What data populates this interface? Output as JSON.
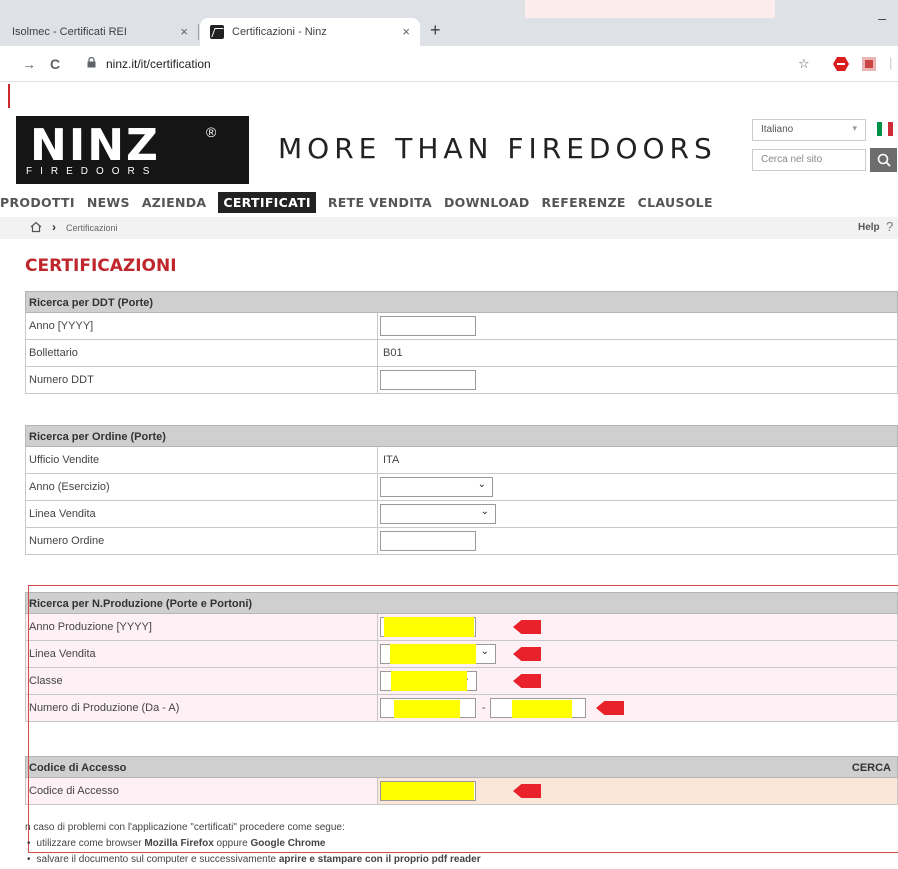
{
  "browser": {
    "tabs": [
      {
        "title": "Isolmec - Certificati REI",
        "active": false
      },
      {
        "title": "Certificazioni - Ninz",
        "active": true
      }
    ],
    "new_tab": "+",
    "close": "×",
    "minimize": "–",
    "url": "ninz.it/it/certification",
    "back": "→",
    "reload": "C",
    "star": "☆"
  },
  "header": {
    "logo_text": "NINZ",
    "logo_sub": "FIREDOORS",
    "logo_reg": "®",
    "slogan": "MORE THAN FIREDOORS",
    "language": "Italiano",
    "search_placeholder": "Cerca nel sito"
  },
  "nav": {
    "items": [
      "PRODOTTI",
      "NEWS",
      "AZIENDA",
      "CERTIFICATI",
      "RETE VENDITA",
      "DOWNLOAD",
      "REFERENZE",
      "CLAUSOLE"
    ],
    "active": "CERTIFICATI"
  },
  "breadcrumb": {
    "current": "Certificazioni",
    "help": "Help",
    "help_q": "?"
  },
  "page_title": "CERTIFICAZIONI",
  "sections": {
    "ddt": {
      "title": "Ricerca per DDT (Porte)",
      "rows": [
        "Anno [YYYY]",
        "Bollettario",
        "Numero DDT"
      ],
      "bollettario_value": "B01"
    },
    "ordine": {
      "title": "Ricerca per Ordine (Porte)",
      "rows": [
        "Ufficio Vendite",
        "Anno (Esercizio)",
        "Linea Vendita",
        "Numero Ordine"
      ],
      "ufficio_value": "ITA"
    },
    "produzione": {
      "title": "Ricerca per N.Produzione (Porte e Portoni)",
      "rows": [
        "Anno Produzione [YYYY]",
        "Linea Vendita",
        "Classe",
        "Numero di Produzione (Da - A)"
      ],
      "range_sep": "-"
    },
    "accesso": {
      "title": "Codice di Accesso",
      "search_label": "CERCA",
      "rows": [
        "Codice di Accesso"
      ]
    }
  },
  "notes": {
    "intro": "n caso di problemi con l'applicazione \"certificati\" procedere come segue:",
    "item1_pre": "utilizzare come browser ",
    "item1_b1": "Mozilla Firefox",
    "item1_mid": " oppure ",
    "item1_b2": "Google Chrome",
    "item2_pre": "salvare il documento sul computer e successivamente ",
    "item2_b": "aprire e stampare con il proprio pdf reader"
  },
  "colors": {
    "title_red": "#c0272d",
    "highlight": "#ffff00",
    "arrow_red": "#e8212a"
  }
}
